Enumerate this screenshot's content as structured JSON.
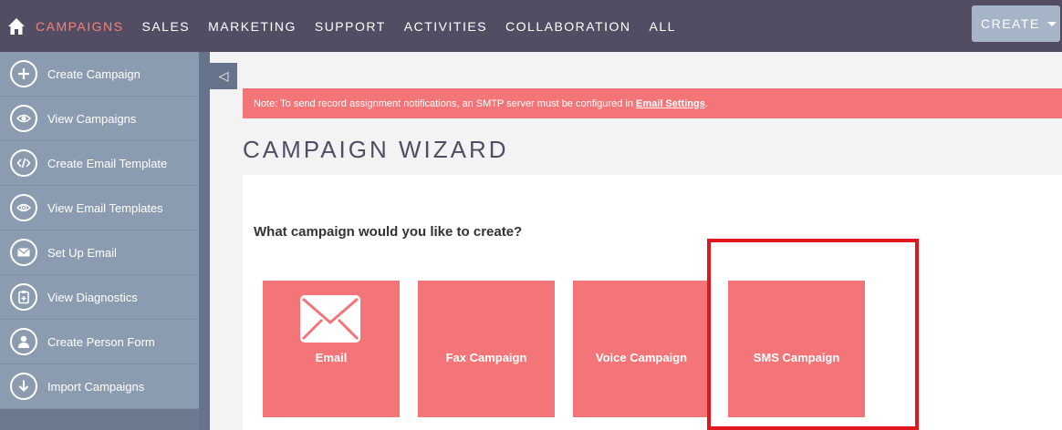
{
  "nav": {
    "items": [
      "CAMPAIGNS",
      "SALES",
      "MARKETING",
      "SUPPORT",
      "ACTIVITIES",
      "COLLABORATION",
      "ALL"
    ],
    "create_label": "CREATE",
    "active_color": "#f08377",
    "bar_color": "#534d64"
  },
  "sidebar": {
    "items": [
      {
        "label": "Create Campaign",
        "icon": "plus-icon"
      },
      {
        "label": "View Campaigns",
        "icon": "eye-icon"
      },
      {
        "label": "Create Email Template",
        "icon": "code-icon"
      },
      {
        "label": "View Email Templates",
        "icon": "eye-icon"
      },
      {
        "label": "Set Up Email",
        "icon": "envelope-icon"
      },
      {
        "label": "View Diagnostics",
        "icon": "clipboard-icon"
      },
      {
        "label": "Create Person Form",
        "icon": "person-icon"
      },
      {
        "label": "Import Campaigns",
        "icon": "download-icon"
      }
    ]
  },
  "notice": {
    "text": "Note: To send record assignment notifications, an SMTP server must be configured in ",
    "link": "Email Settings",
    "end": "."
  },
  "page": {
    "title": "CAMPAIGN WIZARD",
    "question": "What campaign would you like to create?"
  },
  "tiles": [
    {
      "label": "Email"
    },
    {
      "label": "Fax Campaign"
    },
    {
      "label": "Voice Campaign"
    },
    {
      "label": "SMS Campaign"
    }
  ],
  "colors": {
    "tile": "#f47577",
    "highlight": "#e0171e"
  }
}
